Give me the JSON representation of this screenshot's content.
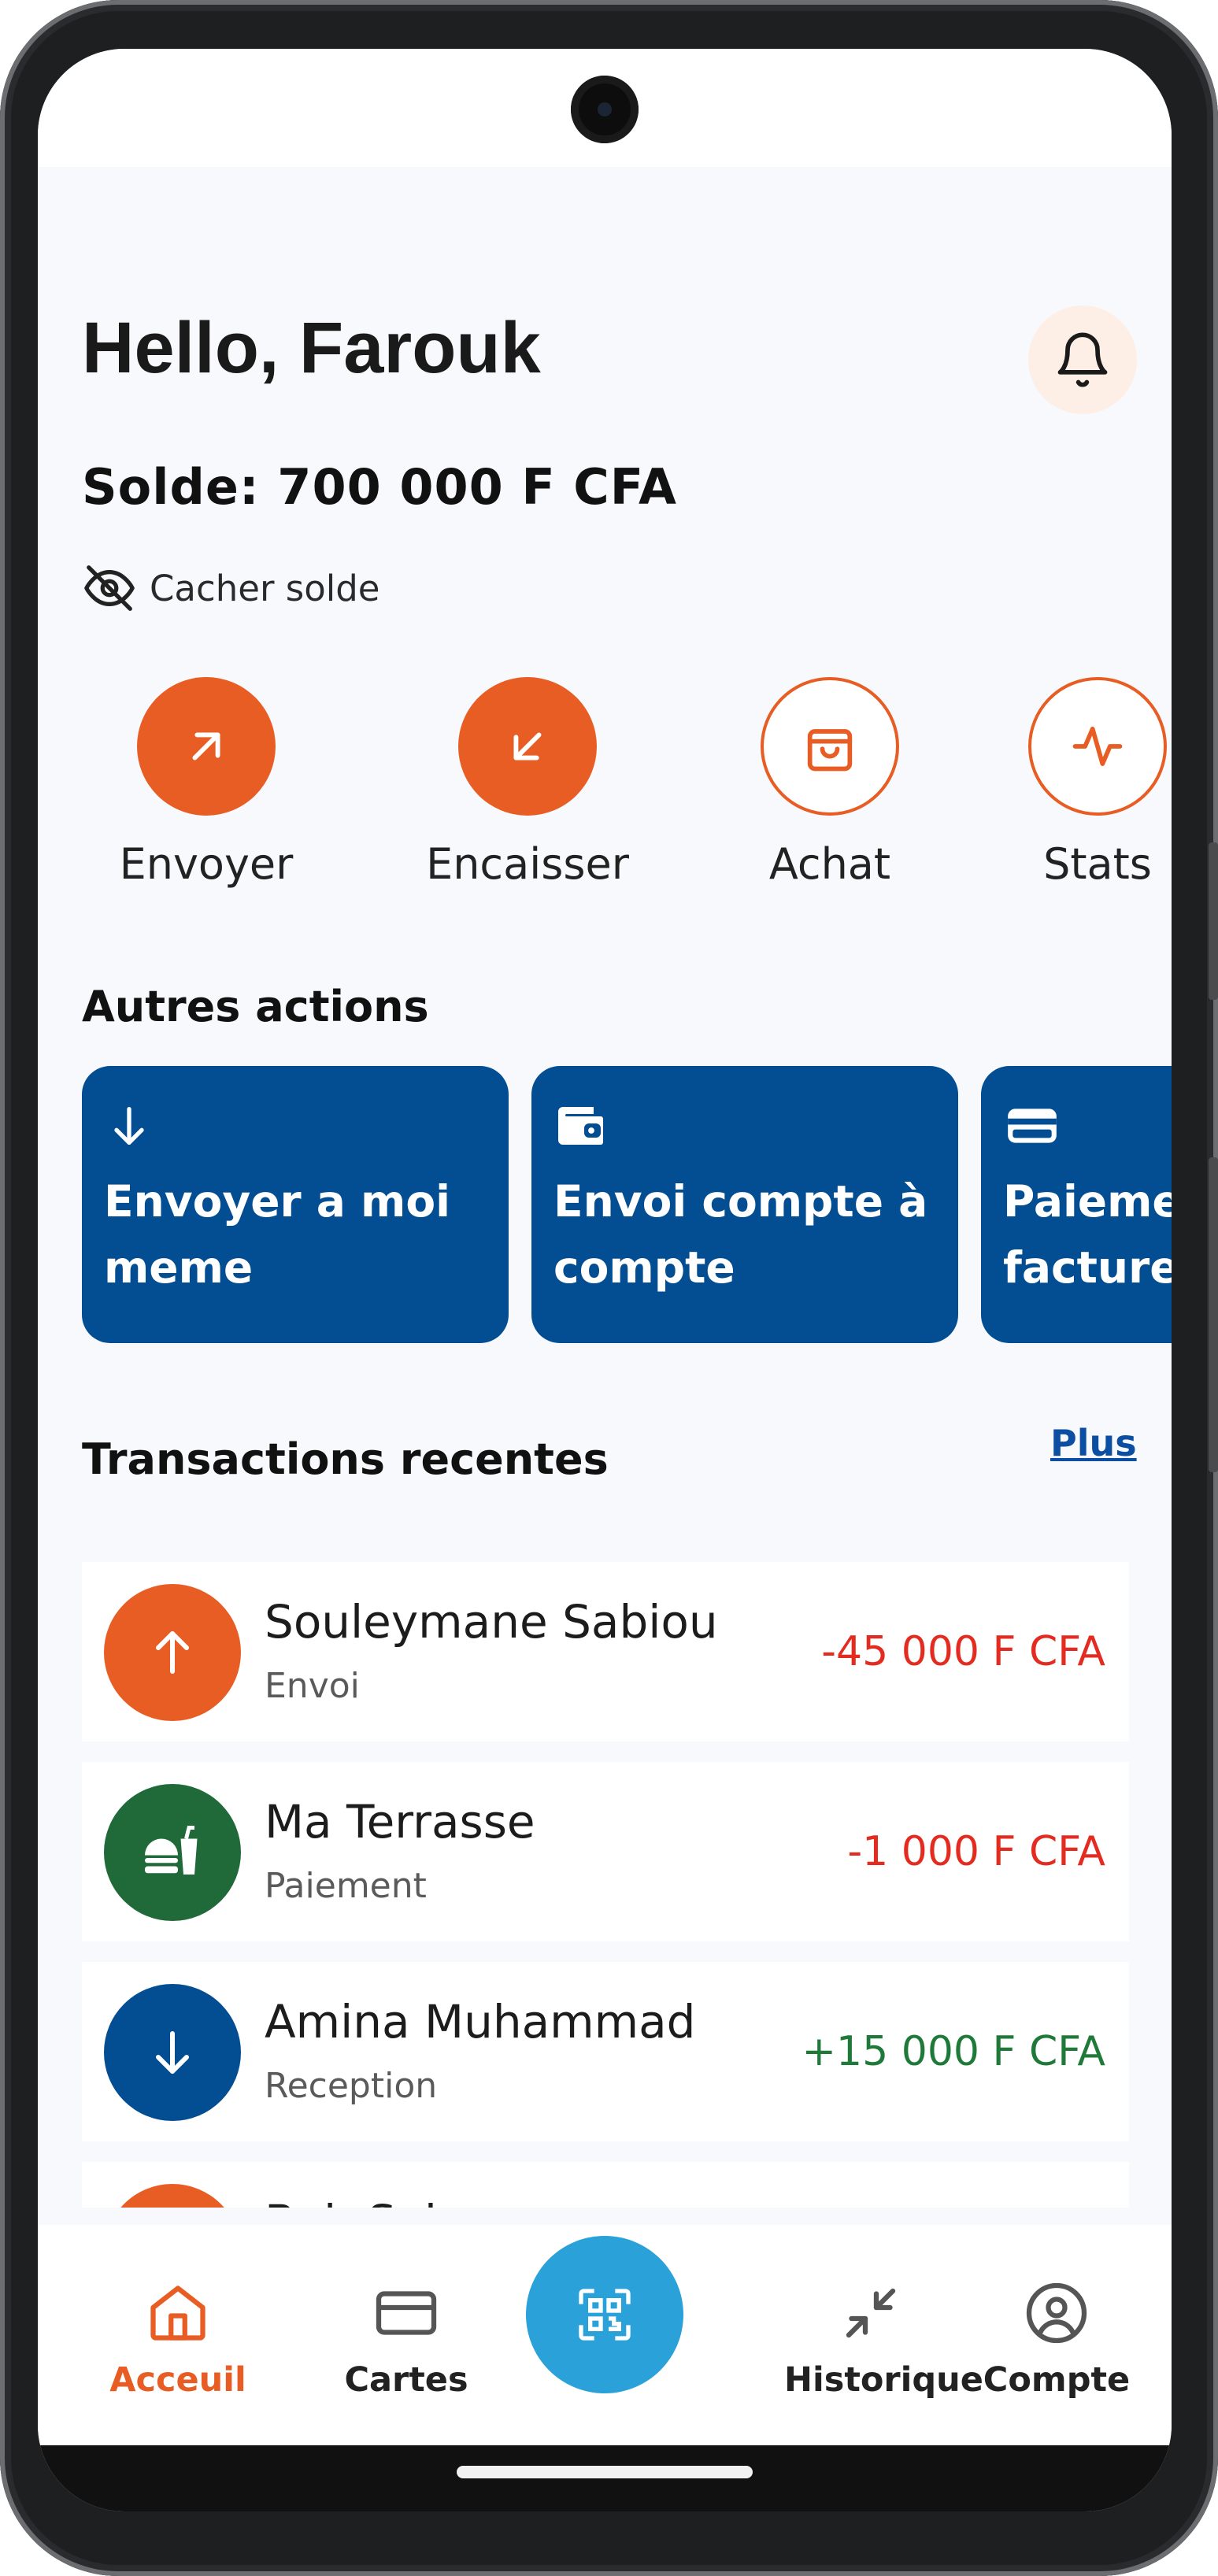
{
  "header": {
    "greeting": "Hello, Farouk",
    "balance": "Solde: 700 000 F CFA",
    "hide_balance": "Cacher solde"
  },
  "quick_actions": [
    {
      "label": "Envoyer",
      "icon": "arrow-up-right-icon"
    },
    {
      "label": "Encaisser",
      "icon": "arrow-down-left-icon"
    },
    {
      "label": "Achat",
      "icon": "shopping-bag-icon"
    },
    {
      "label": "Stats",
      "icon": "activity-icon"
    }
  ],
  "other_actions": {
    "title": "Autres actions",
    "cards": [
      {
        "line1": "Envoyer a moi",
        "line2": "meme",
        "icon": "arrow-down-icon"
      },
      {
        "line1": "Envoi compte à",
        "line2": "compte",
        "icon": "wallet-icon"
      },
      {
        "line1": "Paiement",
        "line2": "facture",
        "icon": "card-icon"
      }
    ]
  },
  "transactions": {
    "title": "Transactions recentes",
    "more": "Plus",
    "items": [
      {
        "name": "Souleymane Sabiou",
        "type": "Envoi",
        "amount": "-45 000 F CFA",
        "icon": "arrow-up-icon"
      },
      {
        "name": "Ma Terrasse",
        "type": "Paiement",
        "amount": "-1 000 F CFA",
        "icon": "food-icon"
      },
      {
        "name": "Amina Muhammad",
        "type": "Reception",
        "amount": "+15 000 F CFA",
        "icon": "arrow-down-icon"
      },
      {
        "name": "Bob Salem",
        "type": "",
        "amount": "",
        "icon": "arrow-up-icon"
      }
    ]
  },
  "bottom_nav": {
    "items": [
      {
        "label": "Acceuil",
        "icon": "home-icon",
        "active": true
      },
      {
        "label": "Cartes",
        "icon": "card-icon"
      },
      {
        "label": "Historique",
        "icon": "collapse-arrows-icon"
      },
      {
        "label": "Compte",
        "icon": "user-circle-icon"
      }
    ],
    "scan_icon": "qr-scan-icon"
  },
  "colors": {
    "accent": "#e85d23",
    "primary": "#034e93",
    "scan": "#2aa1d8",
    "negative": "#e42b1f",
    "positive": "#1f7a3a",
    "food": "#1f6a38"
  }
}
